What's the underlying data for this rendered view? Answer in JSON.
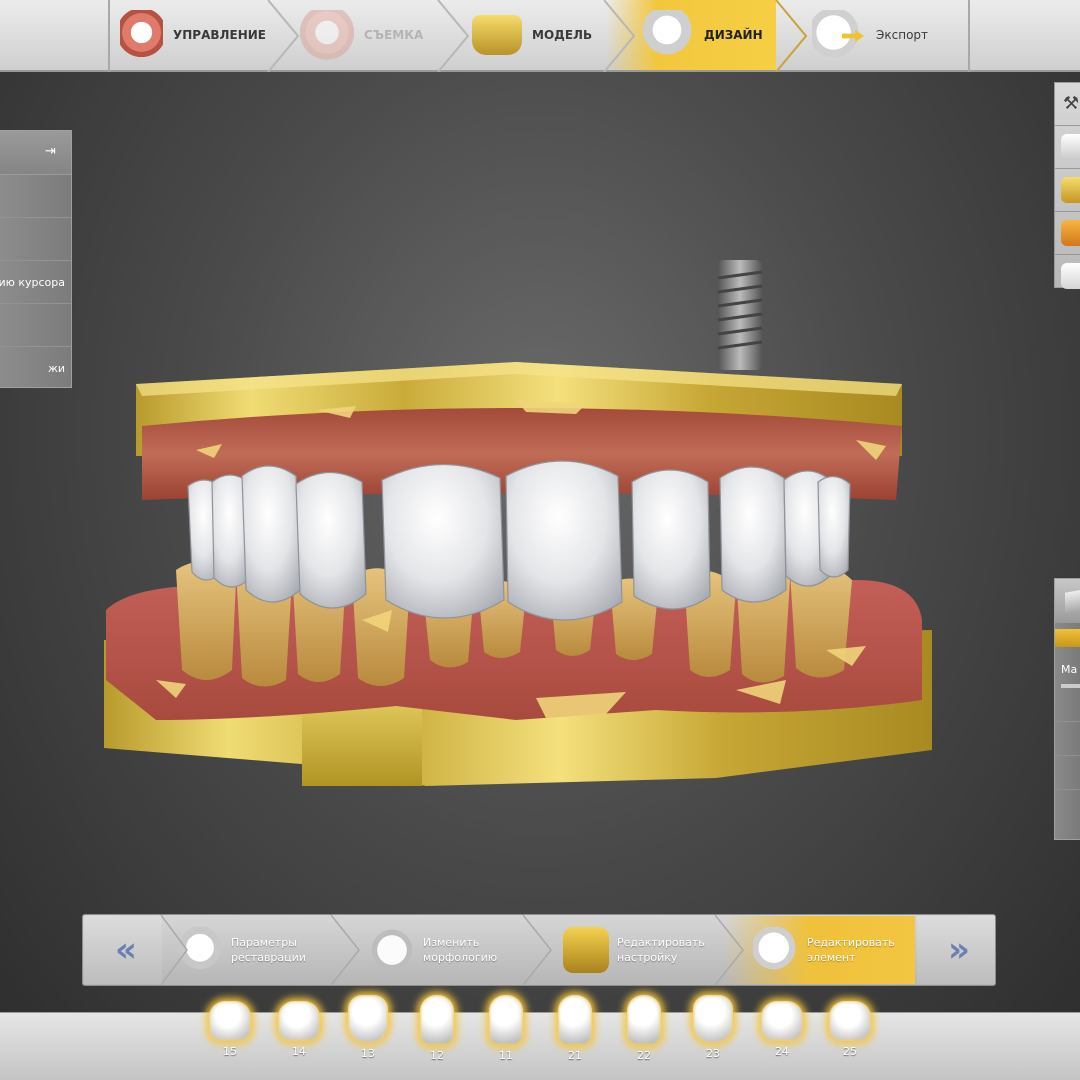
{
  "workflow": {
    "steps": [
      {
        "label": "УПРАВЛЕНИЕ",
        "icon": "dental-arch-icon",
        "state": "normal"
      },
      {
        "label": "СЪЕМКА",
        "icon": "scan-arch-icon",
        "state": "disabled"
      },
      {
        "label": "МОДЕЛЬ",
        "icon": "model-base-icon",
        "state": "normal"
      },
      {
        "label": "ДИЗАЙН",
        "icon": "tooth-mesh-icon",
        "state": "active"
      },
      {
        "label": "Экспорт",
        "icon": "tooth-export-icon",
        "state": "normal"
      }
    ]
  },
  "left_panel": {
    "pin_icon": "pin-panel-icon",
    "rows": [
      "",
      "",
      "ию курсора",
      "",
      "жи"
    ]
  },
  "right_toolbar": {
    "buttons": [
      "tools-icon",
      "scan-plate-icon",
      "gold-model-icon",
      "orange-model-icon",
      "white-tooth-icon"
    ]
  },
  "right_panel": {
    "label": "Ма"
  },
  "viewport": {
    "description_icon": "dental-3d-model"
  },
  "design_steps": {
    "prev_label": "«",
    "next_label": "»",
    "items": [
      {
        "label": "Параметры\nреставрации",
        "icon": "restoration-params-icon",
        "active": false
      },
      {
        "label": "Изменить\nморфологию",
        "icon": "morphology-icon",
        "active": false
      },
      {
        "label": "Редактировать\nнастройку",
        "icon": "edit-setup-icon",
        "active": false
      },
      {
        "label": "Редактировать\nэлемент",
        "icon": "edit-element-icon",
        "active": true
      }
    ]
  },
  "teeth": [
    {
      "number": "15",
      "shape": "molar"
    },
    {
      "number": "14",
      "shape": "molar"
    },
    {
      "number": "13",
      "shape": "canine"
    },
    {
      "number": "12",
      "shape": "incisor"
    },
    {
      "number": "11",
      "shape": "incisor"
    },
    {
      "number": "21",
      "shape": "incisor"
    },
    {
      "number": "22",
      "shape": "incisor"
    },
    {
      "number": "23",
      "shape": "canine"
    },
    {
      "number": "24",
      "shape": "molar"
    },
    {
      "number": "25",
      "shape": "molar"
    }
  ],
  "colors": {
    "accent": "#f2c73d",
    "gum": "#b9574a",
    "model_gold": "#d9c04e",
    "tooth_white": "#e8e8ea"
  }
}
